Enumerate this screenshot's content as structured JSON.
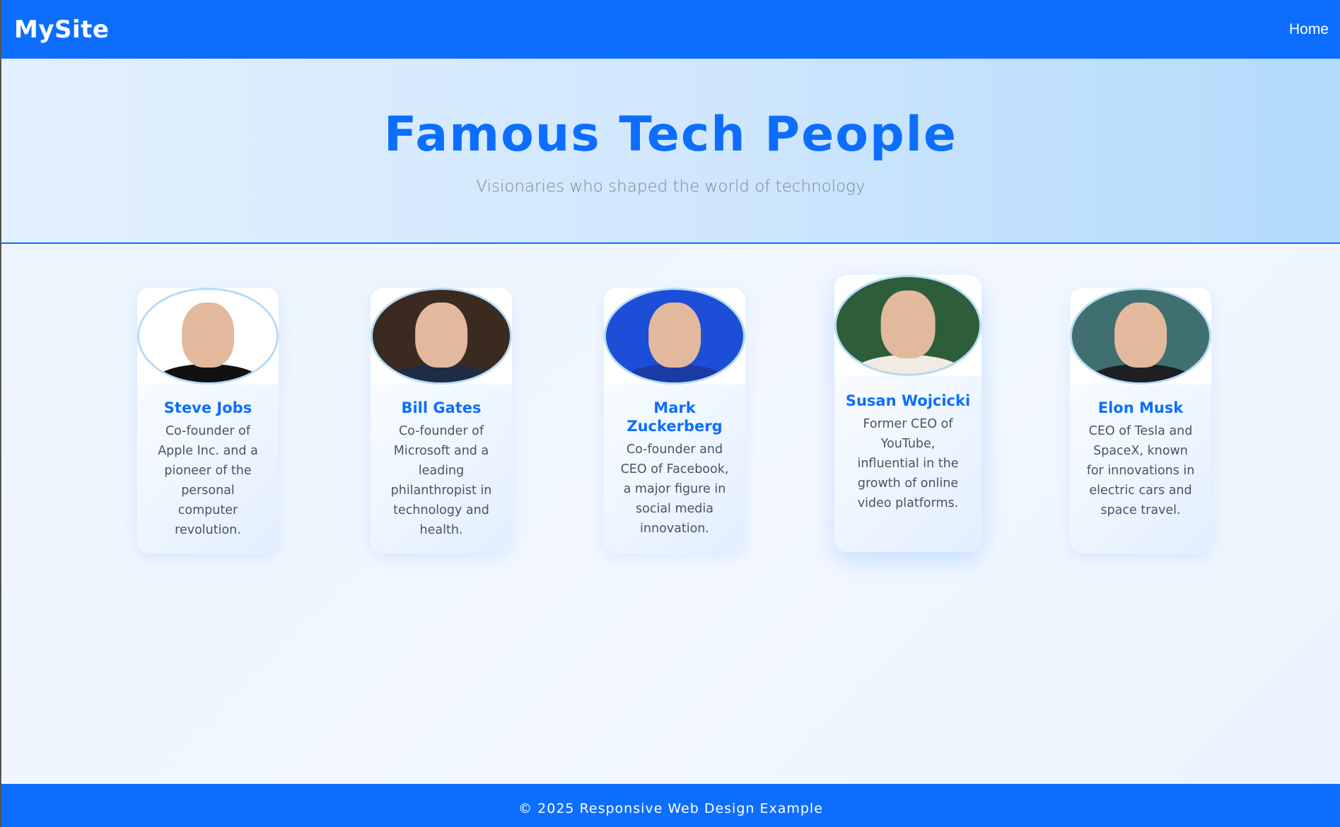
{
  "navbar": {
    "brand": "MySite",
    "links": [
      "Home"
    ]
  },
  "hero": {
    "title": "Famous Tech People",
    "subtitle": "Visionaries who shaped the world of technology"
  },
  "people": [
    {
      "name": "Steve Jobs",
      "description": "Co-founder of Apple Inc. and a pioneer of the personal computer revolution.",
      "photo_bg": "#ffffff",
      "photo_body": "#111111"
    },
    {
      "name": "Bill Gates",
      "description": "Co-founder of Microsoft and a leading philanthropist in technology and health.",
      "photo_bg": "#3b2a1f",
      "photo_body": "#1f2d44"
    },
    {
      "name": "Mark Zuckerberg",
      "description": "Co-founder and CEO of Facebook, a major figure in social media innovation.",
      "photo_bg": "#1d4ed8",
      "photo_body": "#1b3aa3"
    },
    {
      "name": "Susan Wojcicki",
      "description": "Former CEO of YouTube, influential in the growth of online video platforms.",
      "photo_bg": "#2e5d3a",
      "photo_body": "#f1ece3"
    },
    {
      "name": "Elon Musk",
      "description": "CEO of Tesla and SpaceX, known for innovations in electric cars and space travel.",
      "photo_bg": "#3f6f6f",
      "photo_body": "#1d1f22"
    }
  ],
  "footer": {
    "text": "© 2025 Responsive Web Design Example"
  }
}
